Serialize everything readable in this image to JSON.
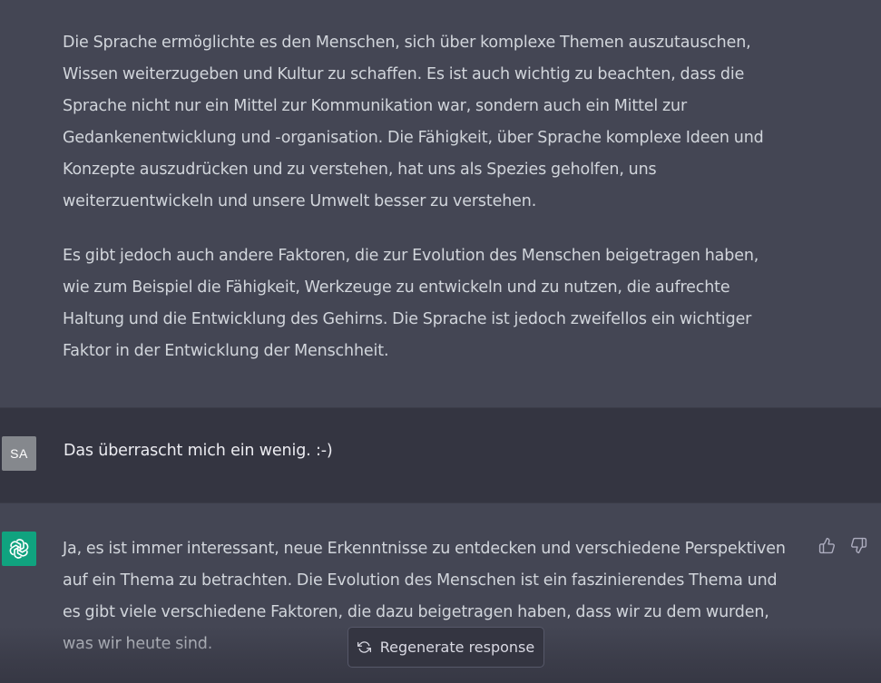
{
  "conversation": {
    "previous_answer": {
      "paragraphs": [
        {
          "lines": [
            "Die Sprache ermöglichte es den Menschen, sich über komplexe Themen auszutauschen,",
            "Wissen weiterzugeben und Kultur zu schaffen. Es ist auch wichtig zu beachten, dass die",
            "Sprache nicht nur ein Mittel zur Kommunikation war, sondern auch ein Mittel zur",
            "Gedankenentwicklung und -organisation. Die Fähigkeit, über Sprache komplexe Ideen und",
            "Konzepte auszudrücken und zu verstehen, hat uns als Spezies geholfen, uns",
            "weiterzuentwickeln und unsere Umwelt besser zu verstehen."
          ]
        },
        {
          "lines": [
            "Es gibt jedoch auch andere Faktoren, die zur Evolution des Menschen beigetragen haben,",
            "wie zum Beispiel die Fähigkeit, Werkzeuge zu entwickeln und zu nutzen, die aufrechte",
            "Haltung und die Entwicklung des Gehirns. Die Sprache ist jedoch zweifellos ein wichtiger",
            "Faktor in der Entwicklung der Menschheit."
          ]
        }
      ]
    },
    "user_message": {
      "avatar_initials": "SA",
      "text": "Das überrascht mich ein wenig. :-)"
    },
    "latest_answer": {
      "lines": [
        "Ja, es ist immer interessant, neue Erkenntnisse zu entdecken und verschiedene Perspektiven",
        "auf ein Thema zu betrachten. Die Evolution des Menschen ist ein faszinierendes Thema und",
        "es gibt viele verschiedene Faktoren, die dazu beigetragen haben, dass wir zu dem wurden,",
        "was wir heute sind."
      ],
      "avatar_icon": "openai-logo-icon",
      "feedback_icons": [
        "thumbs-up-icon",
        "thumbs-down-icon"
      ]
    }
  },
  "controls": {
    "regenerate_label": "Regenerate response",
    "regenerate_icon": "refresh-icon"
  },
  "colors": {
    "assistant_bg": "#444654",
    "user_bg": "#343541",
    "text": "#d1d5db",
    "bot_avatar": "#10a37f",
    "user_avatar": "#85888d"
  }
}
